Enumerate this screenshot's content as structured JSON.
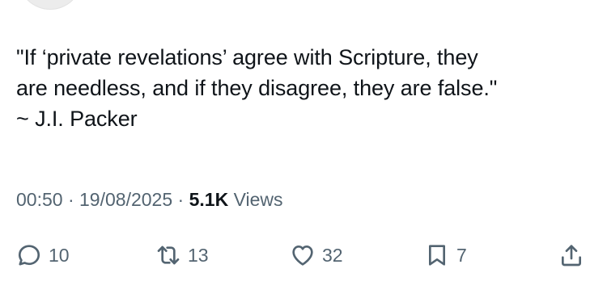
{
  "tweet": {
    "text_lines": [
      "\"If ‘private revelations’ agree with Scripture, they",
      "are needless, and if they disagree, they are false.\"",
      "~ J.I. Packer"
    ],
    "time": "00:50",
    "date": "19/08/2025",
    "separator": " · ",
    "views_count": "5.1K",
    "views_label": " Views"
  },
  "actions": {
    "reply": {
      "icon": "reply-icon",
      "count": "10"
    },
    "repost": {
      "icon": "repost-icon",
      "count": "13"
    },
    "like": {
      "icon": "heart-icon",
      "count": "32"
    },
    "bookmark": {
      "icon": "bookmark-icon",
      "count": "7"
    },
    "share": {
      "icon": "share-icon"
    }
  },
  "colors": {
    "text": "#0f1419",
    "muted": "#536471",
    "background": "#ffffff"
  }
}
